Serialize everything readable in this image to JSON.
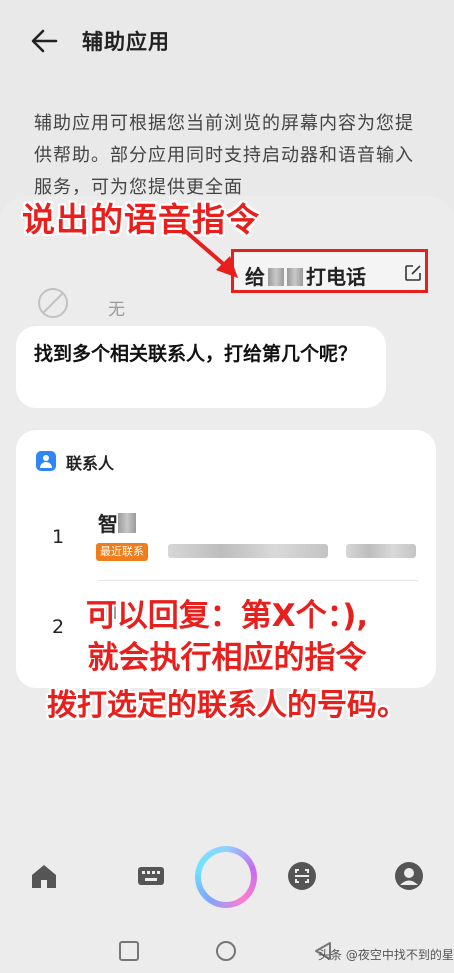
{
  "header": {
    "title": "辅助应用"
  },
  "description": "辅助应用可根据您当前浏览的屏幕内容为您提供帮助。部分应用同时支持启动器和语音输入服务，可为您提供更全面",
  "background_option": "无",
  "annotations": {
    "voice_label": "说出的语音指令",
    "reply_line1": "可以回复：第X个：),",
    "reply_line2": "就会执行相应的指令",
    "reply_line3": "拨打选定的联系人的号码。"
  },
  "voice_command": {
    "prefix": "给",
    "suffix": "打电话"
  },
  "assistant_reply": "找到多个相关联系人，打给第几个呢？",
  "contacts_card": {
    "title": "联系人",
    "rows": [
      {
        "index": "1",
        "name_prefix": "智",
        "badge": "最近联系"
      },
      {
        "index": "2",
        "name_prefix": ""
      }
    ]
  },
  "watermark": "头条 @夜空中找不到的星",
  "colors": {
    "annotation_red": "#e8201d",
    "badge_orange": "#f07d1a",
    "contact_blue": "#2f86f5"
  }
}
